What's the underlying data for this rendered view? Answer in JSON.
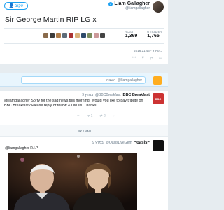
{
  "tweet": {
    "follow_label": "עקוב",
    "author_name": "Liam Gallagher",
    "author_handle": "@liamgallagher",
    "text": "Sir George Martin RIP LG x",
    "stats": [
      {
        "label": "ציוצים מחדש",
        "value": "1,765"
      },
      {
        "label": "אהבתי",
        "value": "1,369"
      }
    ],
    "date": "2016 במרץ 9 - 21:43",
    "liker_colors": [
      "#8a6b4c",
      "#3b3b3b",
      "#b07d4a",
      "#5c6b78",
      "#a33",
      "#d9b27a",
      "#2e4a6b",
      "#7a8c5d",
      "#c99",
      "#444"
    ]
  },
  "reply": {
    "placeholder": "השב ל- @liamgallagher"
  },
  "bbc_reply": {
    "name": "BBC Breakfast",
    "handle": "@BBCBreakfast",
    "time": "9 במרץ",
    "avatar_text": "BBC",
    "text": "@liamgallagher Sorry for the sad news this morning. Would you like to pay tribute on BBC Breakfast? Please reply or follow & DM us. Thanks.",
    "counts": {
      "retweets": "2",
      "likes": "1"
    }
  },
  "more_replies": "הצגת עוד",
  "oasis_reply": {
    "name": "~oasis~",
    "handle": "@OasisLiveGem",
    "time": "9 במרץ",
    "text": "@liamgallagher R.I.P"
  }
}
